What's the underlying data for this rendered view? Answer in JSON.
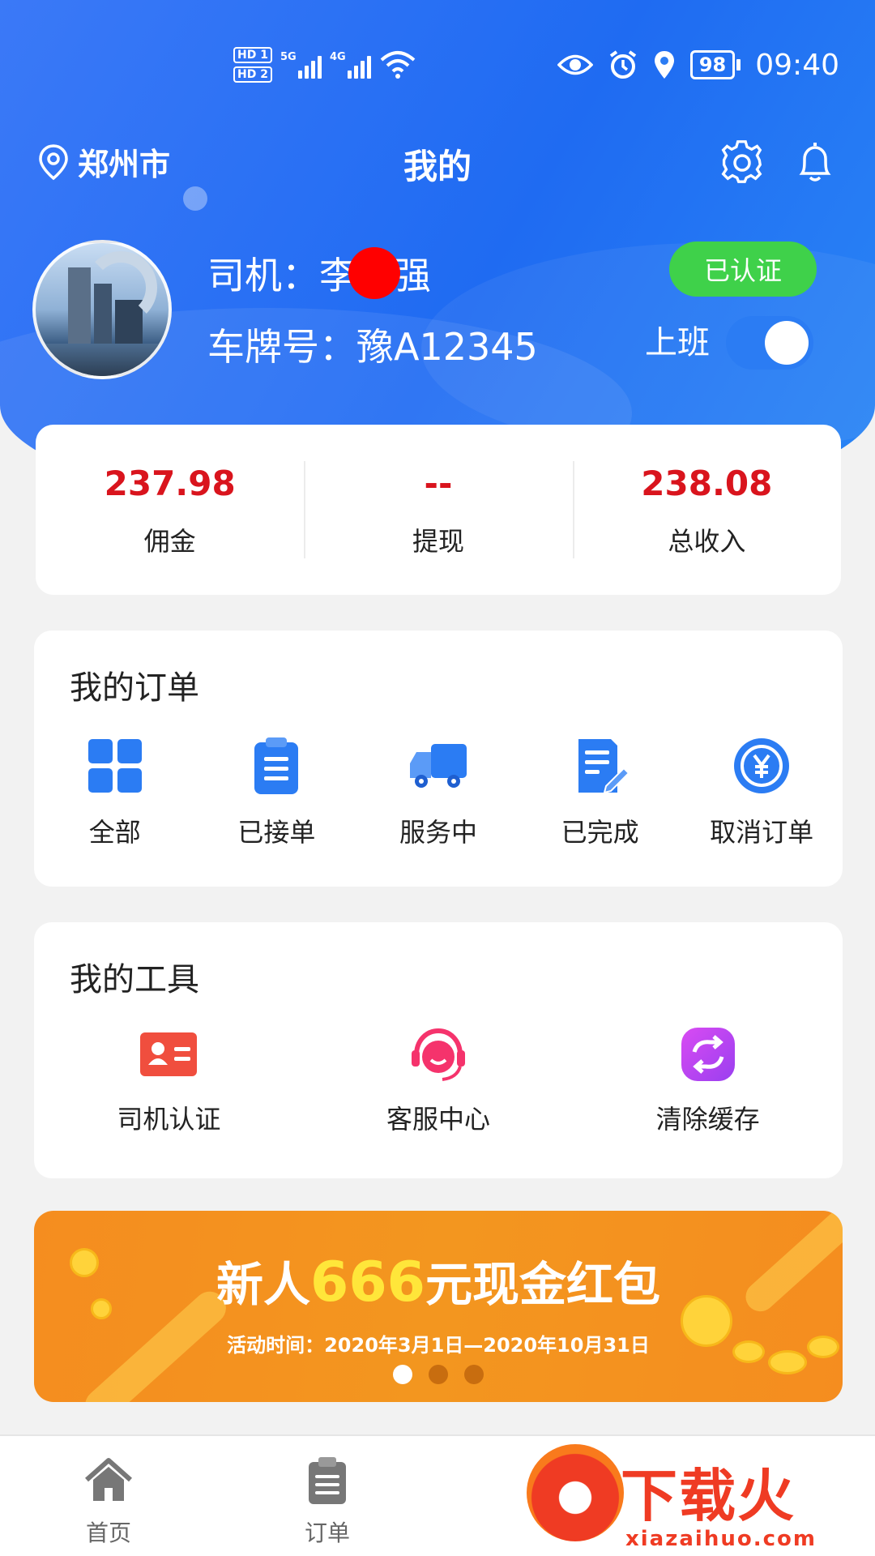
{
  "status_bar": {
    "hd1": "HD 1",
    "hd2": "HD 2",
    "signal1_label": "5G",
    "signal2_label": "4G",
    "battery": "98",
    "time": "09:40"
  },
  "header": {
    "location": "郑州市",
    "title": "我的",
    "icons": [
      "location-pin-icon",
      "settings-icon",
      "bell-icon"
    ]
  },
  "profile": {
    "driver_label": "司机：",
    "driver_name_first": "李",
    "driver_name_last": "强",
    "plate_label": "车牌号：",
    "plate_number": "豫A12345",
    "verified_label": "已认证",
    "on_duty_label": "上班",
    "on_duty": true
  },
  "stats": [
    {
      "value": "237.98",
      "label": "佣金"
    },
    {
      "value": "--",
      "label": "提现"
    },
    {
      "value": "238.08",
      "label": "总收入"
    }
  ],
  "orders": {
    "title": "我的订单",
    "items": [
      {
        "label": "全部",
        "icon": "grid-icon"
      },
      {
        "label": "已接单",
        "icon": "clipboard-icon"
      },
      {
        "label": "服务中",
        "icon": "truck-icon"
      },
      {
        "label": "已完成",
        "icon": "document-edit-icon"
      },
      {
        "label": "取消订单",
        "icon": "yuan-refund-icon"
      }
    ]
  },
  "tools": {
    "title": "我的工具",
    "items": [
      {
        "label": "司机认证",
        "icon": "id-card-icon"
      },
      {
        "label": "客服中心",
        "icon": "headset-icon"
      },
      {
        "label": "清除缓存",
        "icon": "refresh-icon"
      }
    ]
  },
  "banner": {
    "title_prefix": "新人",
    "title_amount": "666",
    "title_suffix": "元现金红包",
    "subtitle": "活动时间：2020年3月1日—2020年10月31日",
    "active_slide": 1,
    "slide_count": 3
  },
  "tabbar": {
    "tabs": [
      {
        "label": "首页",
        "icon": "home-icon"
      },
      {
        "label": "订单",
        "icon": "clipboard-list-icon"
      }
    ]
  },
  "watermark": {
    "text": "下载火",
    "url": "xiazaihuo.com"
  },
  "colors": {
    "primary": "#2b7cf3",
    "amount_red": "#d9141d",
    "verified_green": "#3fd14a",
    "banner_orange": "#f58d1f"
  }
}
